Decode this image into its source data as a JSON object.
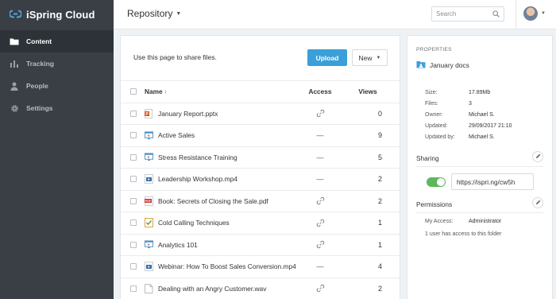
{
  "app": {
    "name": "iSpring Cloud"
  },
  "sidebar": {
    "items": [
      {
        "label": "Content",
        "icon": "folder-icon",
        "active": true
      },
      {
        "label": "Tracking",
        "icon": "bar-chart-icon",
        "active": false
      },
      {
        "label": "People",
        "icon": "person-icon",
        "active": false
      },
      {
        "label": "Settings",
        "icon": "gear-icon",
        "active": false
      }
    ]
  },
  "header": {
    "title": "Repository",
    "search_placeholder": "Search"
  },
  "main": {
    "info_text": "Use this page to share files.",
    "upload_label": "Upload",
    "new_label": "New",
    "columns": {
      "name": "Name",
      "sort_indicator": "↓",
      "access": "Access",
      "views": "Views"
    },
    "rows": [
      {
        "name": "January Report.pptx",
        "type": "pptx",
        "access": "link",
        "views": "0"
      },
      {
        "name": "Active Sales",
        "type": "course",
        "access": "—",
        "views": "9"
      },
      {
        "name": "Stress Resistance Training",
        "type": "course",
        "access": "—",
        "views": "5"
      },
      {
        "name": "Leadership Workshop.mp4",
        "type": "video",
        "access": "—",
        "views": "2"
      },
      {
        "name": "Book: Secrets of Closing the Sale.pdf",
        "type": "pdf",
        "access": "link",
        "views": "2"
      },
      {
        "name": "Cold Calling Techniques",
        "type": "quiz",
        "access": "link",
        "views": "1"
      },
      {
        "name": "Analytics 101",
        "type": "course",
        "access": "link",
        "views": "1"
      },
      {
        "name": "Webinar: How To Boost Sales Conversion.mp4",
        "type": "video",
        "access": "—",
        "views": "4"
      },
      {
        "name": "Dealing with an Angry Customer.wav",
        "type": "audio",
        "access": "link",
        "views": "2"
      }
    ]
  },
  "properties": {
    "title": "PROPERTIES",
    "folder_name": "January docs",
    "meta": [
      {
        "label": "Size:",
        "value": "17.89Mb"
      },
      {
        "label": "Files:",
        "value": "3"
      },
      {
        "label": "Owner:",
        "value": "Michael S."
      },
      {
        "label": "Updated:",
        "value": "29/09/2017 21:10"
      },
      {
        "label": "Updated by:",
        "value": "Michael S."
      }
    ],
    "sharing": {
      "title": "Sharing",
      "enabled": true,
      "link": "https://ispri.ng/cw5h"
    },
    "permissions": {
      "title": "Permissions",
      "my_access_label": "My Access:",
      "my_access_value": "Administrator",
      "summary": "1 user has access to this folder"
    }
  },
  "colors": {
    "sidebar": "#3a3f46",
    "sidebar_active": "#2d3238",
    "accent": "#3b9fd8",
    "toggle_on": "#5cb85c"
  }
}
